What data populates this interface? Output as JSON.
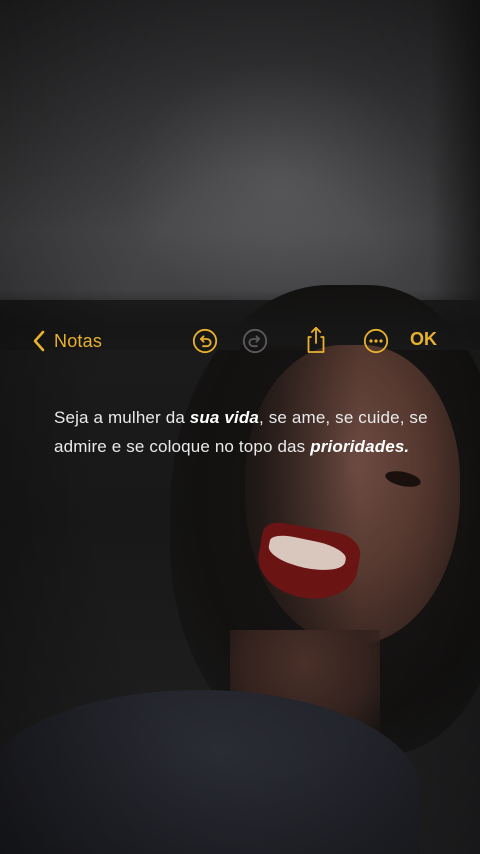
{
  "toolbar": {
    "back_label": "Notas",
    "ok_label": "OK",
    "icons": {
      "back": "chevron-left-icon",
      "undo": "undo-icon",
      "redo": "redo-icon",
      "share": "share-icon",
      "more": "more-options-icon"
    },
    "accent_color": "#e9b130"
  },
  "note": {
    "segments": [
      {
        "text": "Seja a mulher da ",
        "style": "normal"
      },
      {
        "text": "sua vida",
        "style": "bold-italic"
      },
      {
        "text": ", se ame, se cuide, se admire e se coloque no topo das ",
        "style": "normal"
      },
      {
        "text": "prioridades.",
        "style": "bold-italic"
      }
    ]
  }
}
